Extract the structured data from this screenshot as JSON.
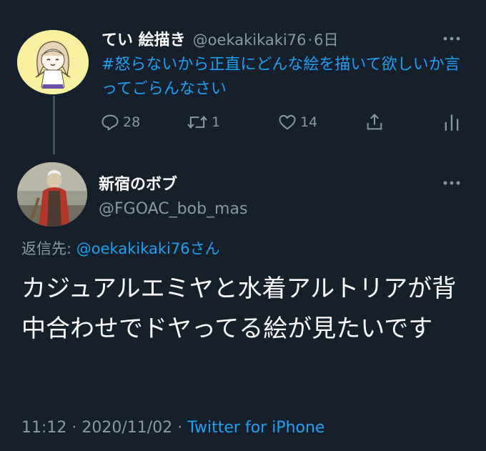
{
  "parent_tweet": {
    "display_name": "てい 絵描き",
    "handle": "@oekakikaki76",
    "separator": "·",
    "time_ago": "6日",
    "text": "#怒らないから正直にどんな絵を描いて欲しいか言ってごらんなさい",
    "actions": {
      "reply_count": "28",
      "retweet_count": "1",
      "like_count": "14"
    },
    "icons": [
      "more-icon",
      "reply-icon",
      "retweet-icon",
      "like-icon",
      "share-icon",
      "analytics-icon"
    ]
  },
  "main_tweet": {
    "display_name": "新宿のボブ",
    "handle": "@FGOAC_bob_mas",
    "reply_label": "返信先:",
    "reply_mention": "@oekakikaki76さん",
    "text": "カジュアルエミヤと水着アルトリアが背中合わせでドヤってる絵が見たいです",
    "time": "11:12",
    "separator": "·",
    "date": "2020/11/02",
    "source": "Twitter for iPhone"
  },
  "colors": {
    "background": "#15202b",
    "accent": "#1da1f2",
    "secondary_text": "#8899a6",
    "primary_text": "#ffffff"
  }
}
